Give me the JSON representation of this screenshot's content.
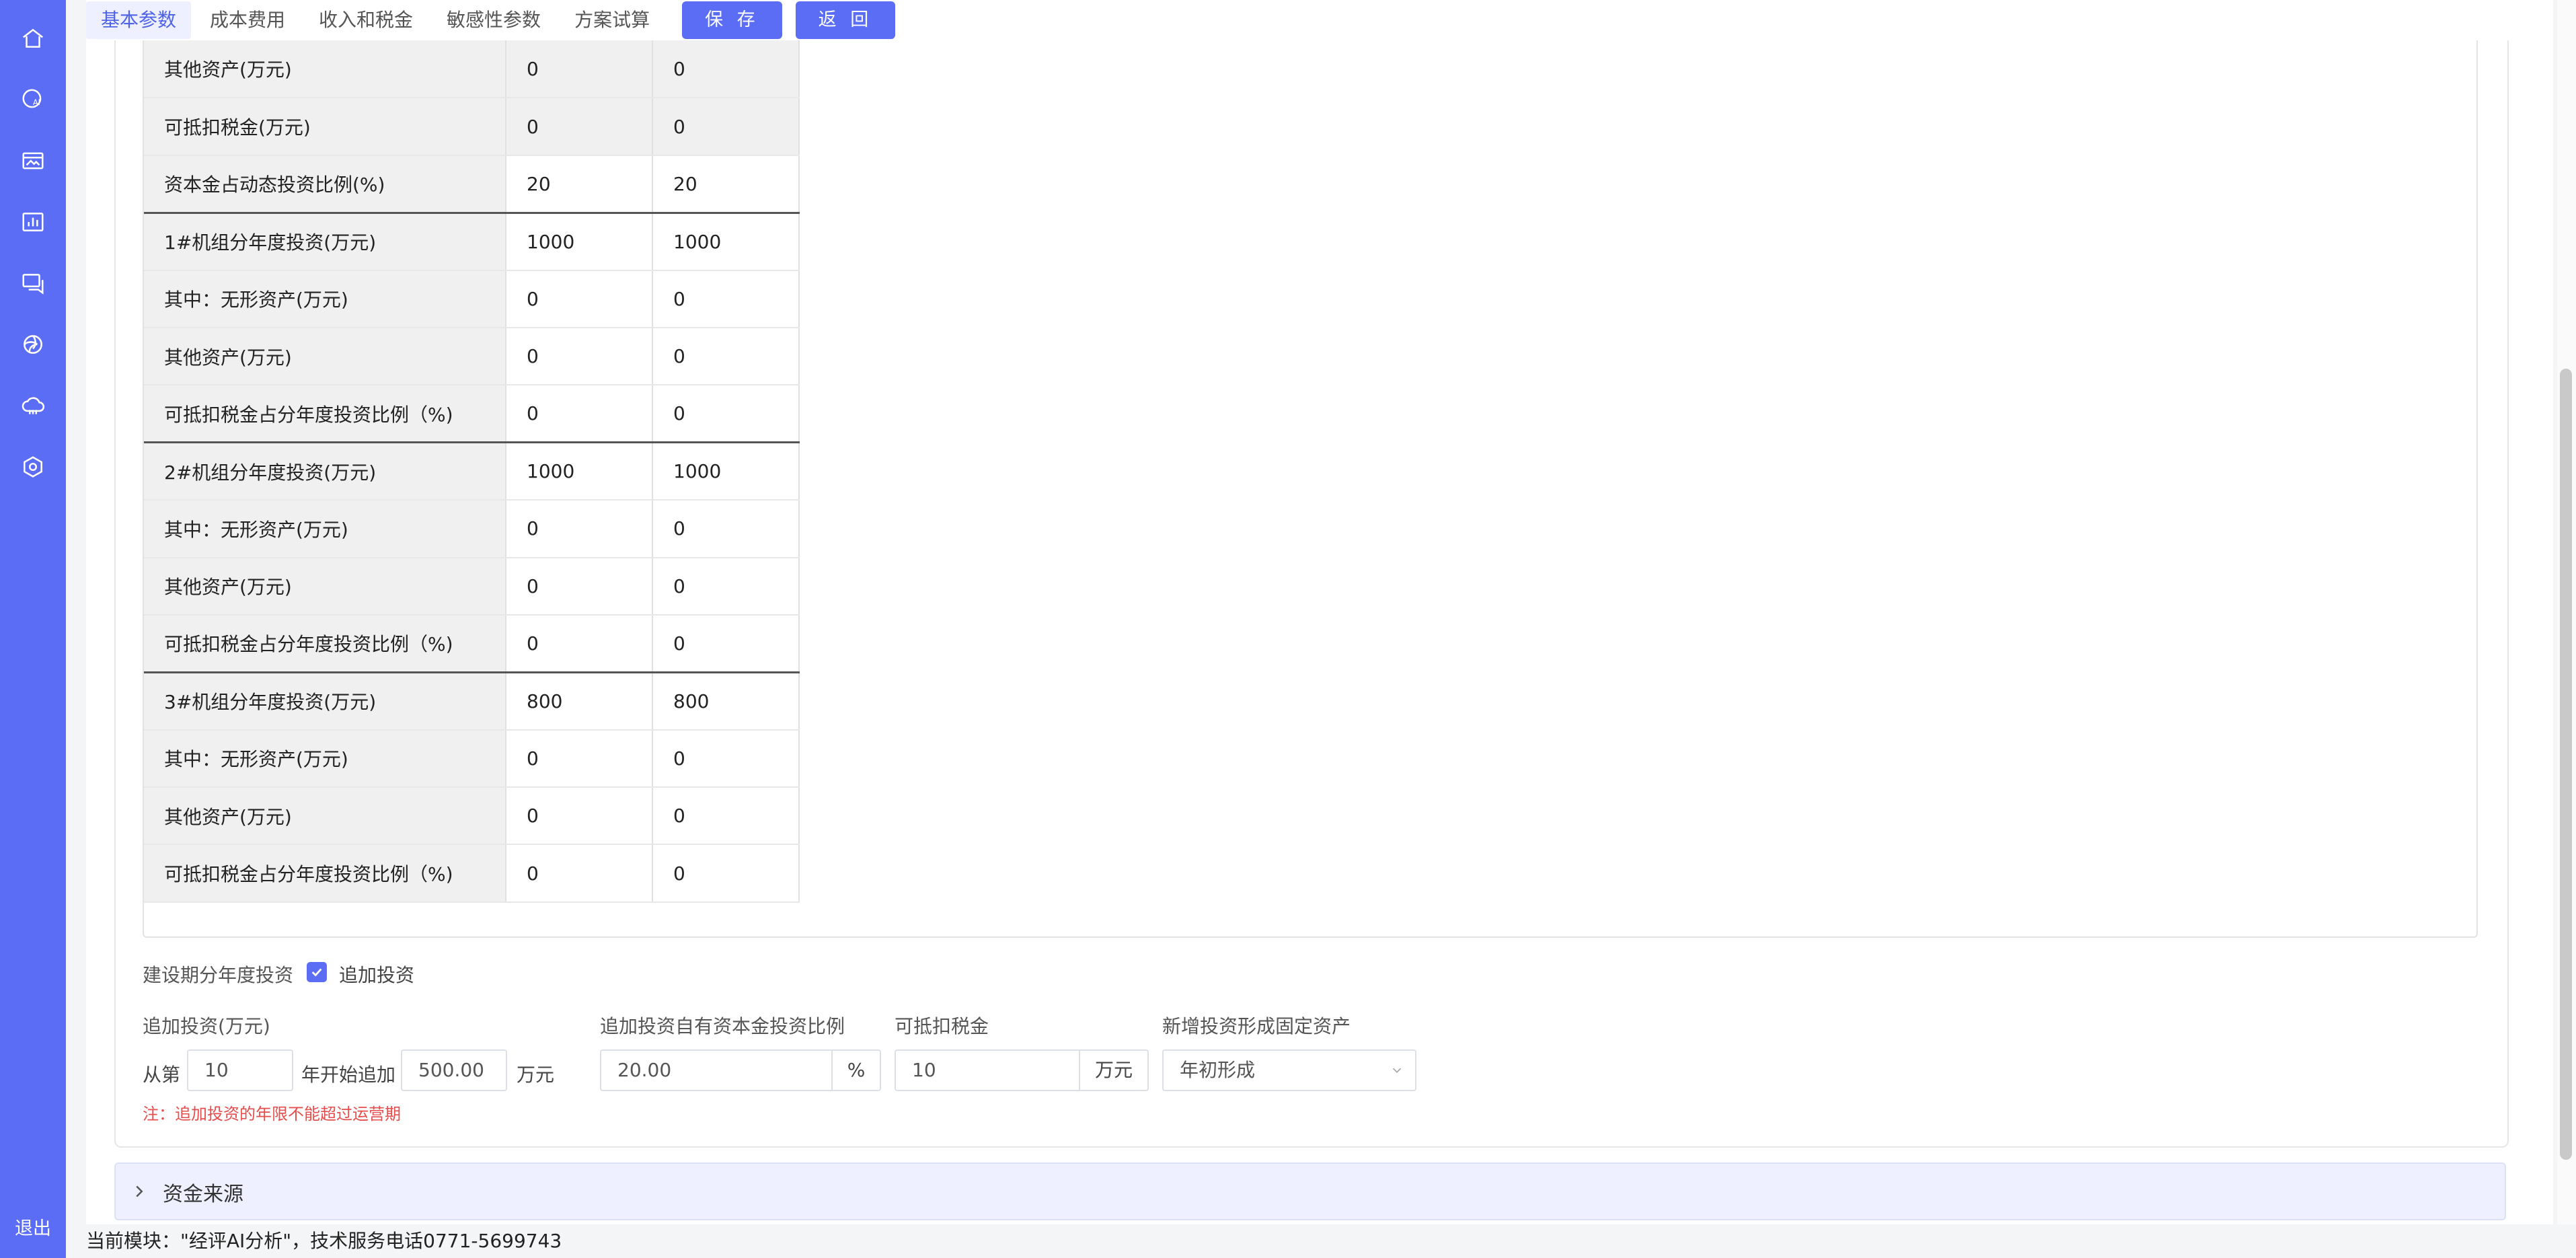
{
  "sidebar": {
    "icons": [
      "home-icon",
      "ai-analysis-icon",
      "image-icon",
      "chart-icon",
      "message-icon",
      "aperture-icon",
      "cloud-icon",
      "settings-icon"
    ],
    "logout_label": "退出"
  },
  "tabs": [
    "基本参数",
    "成本费用",
    "收入和税金",
    "敏感性参数",
    "方案试算"
  ],
  "toolbar": {
    "save_label": "保 存",
    "back_label": "返 回"
  },
  "table": {
    "rows": [
      {
        "label": "其他资产(万元)",
        "v1": "0",
        "v2": "0"
      },
      {
        "label": "可抵扣税金(万元)",
        "v1": "0",
        "v2": "0"
      },
      {
        "label": "资本金占动态投资比例(%)",
        "v1": "20",
        "v2": "20"
      },
      {
        "label": "1#机组分年度投资(万元)",
        "v1": "1000",
        "v2": "1000"
      },
      {
        "label": "其中：无形资产(万元)",
        "v1": "0",
        "v2": "0"
      },
      {
        "label": "其他资产(万元)",
        "v1": "0",
        "v2": "0"
      },
      {
        "label": "可抵扣税金占分年度投资比例（%)",
        "v1": "0",
        "v2": "0"
      },
      {
        "label": "2#机组分年度投资(万元)",
        "v1": "1000",
        "v2": "1000"
      },
      {
        "label": "其中：无形资产(万元)",
        "v1": "0",
        "v2": "0"
      },
      {
        "label": "其他资产(万元)",
        "v1": "0",
        "v2": "0"
      },
      {
        "label": "可抵扣税金占分年度投资比例（%)",
        "v1": "0",
        "v2": "0"
      },
      {
        "label": "3#机组分年度投资(万元)",
        "v1": "800",
        "v2": "800"
      },
      {
        "label": "其中：无形资产(万元)",
        "v1": "0",
        "v2": "0"
      },
      {
        "label": "其他资产(万元)",
        "v1": "0",
        "v2": "0"
      },
      {
        "label": "可抵扣税金占分年度投资比例（%)",
        "v1": "0",
        "v2": "0"
      }
    ]
  },
  "add_investment": {
    "section_label": "建设期分年度投资",
    "checkbox_label": "追加投资",
    "checked": true,
    "amount_label": "追加投资(万元)",
    "from_prefix": "从第",
    "start_year": "10",
    "year_suffix": "年开始追加",
    "amount_value": "500.00",
    "amount_unit": "万元",
    "note": "注：追加投资的年限不能超过运营期",
    "ratio_label": "追加投资自有资本金投资比例",
    "ratio_value": "20.00",
    "ratio_unit": "%",
    "tax_label": "可抵扣税金",
    "tax_value": "10",
    "tax_unit": "万元",
    "asset_label": "新增投资形成固定资产",
    "asset_value": "年初形成"
  },
  "funding": {
    "title": "资金来源"
  },
  "status": {
    "text": "当前模块：\"经评AI分析\"，技术服务电话0771-5699743"
  },
  "colors": {
    "accent": "#5b6cf5",
    "warning": "#e64d4d"
  }
}
